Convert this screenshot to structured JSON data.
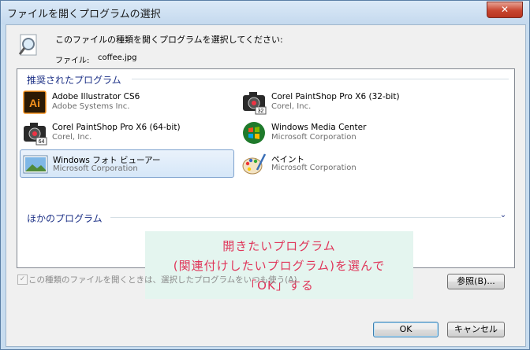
{
  "window": {
    "title": "ファイルを開くプログラムの選択",
    "close_label": "✕"
  },
  "header": {
    "instruction": "このファイルの種類を開くプログラムを選択してください:",
    "file_label": "ファイル:",
    "file_name": "coffee.jpg"
  },
  "recommended": {
    "label": "推奨されたプログラム",
    "programs": [
      {
        "name": "Adobe Illustrator CS6",
        "vendor": "Adobe Systems Inc.",
        "icon": "illustrator-icon"
      },
      {
        "name": "Corel PaintShop Pro X6 (32-bit)",
        "vendor": "Corel, Inc.",
        "icon": "paintshop-32-icon",
        "badge": "32"
      },
      {
        "name": "Corel PaintShop Pro X6 (64-bit)",
        "vendor": "Corel, Inc.",
        "icon": "paintshop-64-icon",
        "badge": "64"
      },
      {
        "name": "Windows Media Center",
        "vendor": "Microsoft Corporation",
        "icon": "media-center-icon"
      },
      {
        "name": "Windows フォト ビューアー",
        "vendor": "Microsoft Corporation",
        "icon": "photo-viewer-icon",
        "selected": true
      },
      {
        "name": "ペイント",
        "vendor": "Microsoft Corporation",
        "icon": "paint-icon"
      }
    ]
  },
  "other": {
    "label": "ほかのプログラム"
  },
  "annotation": {
    "line1": "開きたいプログラム",
    "line2": "(関連付けしたいプログラム)を選んで",
    "line3": "「OK」する"
  },
  "always_use": {
    "label": "この種類のファイルを開くときは、選択したプログラムをいつも使う(A)",
    "checked": true,
    "enabled": false
  },
  "buttons": {
    "browse": "参照(B)...",
    "ok": "OK",
    "cancel": "キャンセル"
  },
  "colors": {
    "group_label": "#1e3287",
    "annotation_text": "#e0365a",
    "annotation_bg": "#e4f5ef"
  }
}
